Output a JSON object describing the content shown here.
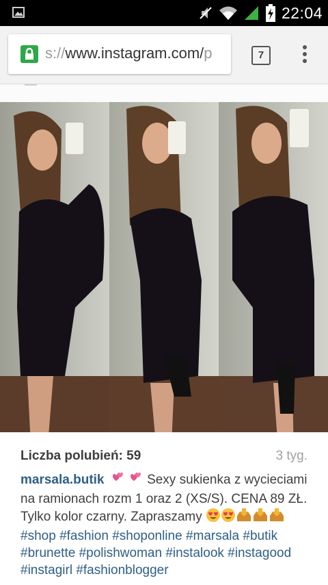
{
  "status_bar": {
    "time": "22:04",
    "icons": [
      "image-notification-icon",
      "muted-icon",
      "wifi-icon",
      "signal-icon",
      "battery-charging-icon"
    ]
  },
  "browser": {
    "url_prefix": "s://",
    "url_main": "www.instagram.com/",
    "url_suffix": "p",
    "tab_count": "7",
    "lock_color": "#2ea84a"
  },
  "post": {
    "likes_label": "Liczba polubień: 59",
    "time_ago": "3 tyg.",
    "username": "marsala.butik",
    "caption_text": "Sexy sukienka z wycieciami na ramionach rozm 1 oraz 2 (XS/S). CENA 89 ZŁ. Tylko kolor czarny. Zapraszamy",
    "emojis_after_username": [
      "revolving-hearts-icon",
      "revolving-hearts-icon"
    ],
    "emojis_after_caption": [
      "heart-eyes-icon",
      "heart-eyes-icon",
      "inbox-tray-icon",
      "inbox-tray-icon",
      "inbox-tray-icon"
    ],
    "hashtags": [
      "#shop",
      "#fashion",
      "#shoponline",
      "#marsala",
      "#butik",
      "#brunette",
      "#polishwoman",
      "#instalook",
      "#instagood",
      "#instagirl",
      "#fashionblogger"
    ],
    "link_color": "#2e5e86"
  }
}
